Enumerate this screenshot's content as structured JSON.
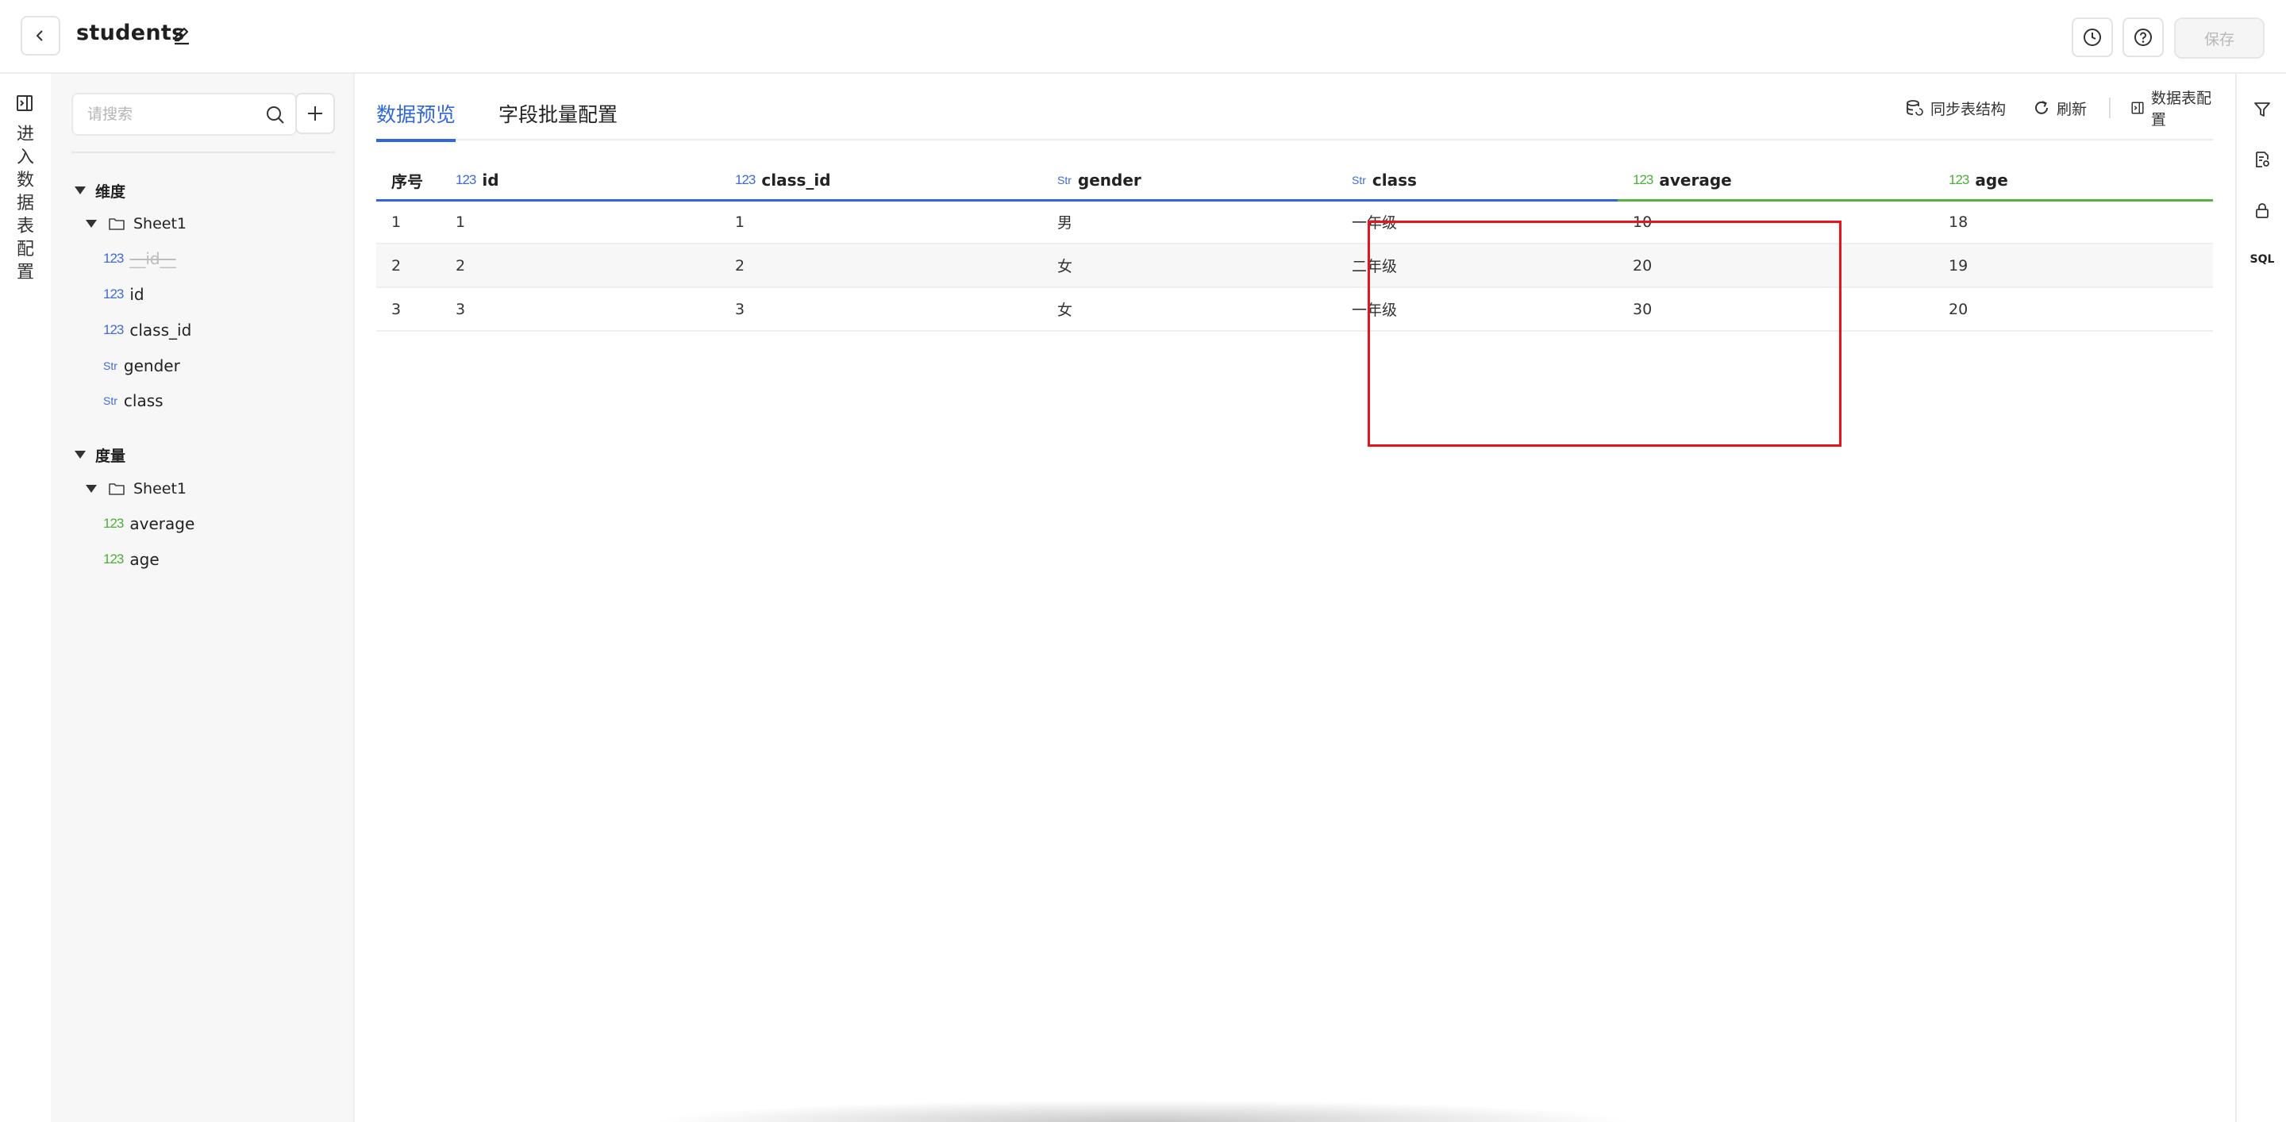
{
  "header": {
    "title": "students",
    "save_label": "保存",
    "icons": {
      "back": "chevron-left-icon",
      "edit": "pencil-icon",
      "history": "clock-icon",
      "help": "question-circle-icon"
    }
  },
  "left_rail": {
    "label_chars": [
      "进",
      "入",
      "数",
      "据",
      "表",
      "配",
      "置"
    ],
    "icon": "panel-collapse-icon"
  },
  "side_panel": {
    "search_placeholder": "请搜索",
    "dimension": {
      "label": "维度",
      "folder": "Sheet1",
      "fields": [
        {
          "type": "123",
          "name": "__id__",
          "disabled": true
        },
        {
          "type": "123",
          "name": "id"
        },
        {
          "type": "123",
          "name": "class_id"
        },
        {
          "type": "Str",
          "name": "gender"
        },
        {
          "type": "Str",
          "name": "class"
        }
      ]
    },
    "measure": {
      "label": "度量",
      "folder": "Sheet1",
      "fields": [
        {
          "type": "123",
          "name": "average"
        },
        {
          "type": "123",
          "name": "age"
        }
      ]
    }
  },
  "main": {
    "tabs": [
      {
        "label": "数据预览",
        "active": true
      },
      {
        "label": "字段批量配置",
        "active": false
      }
    ],
    "toolbar": {
      "sync_label": "同步表结构",
      "refresh_label": "刷新",
      "config_label": "数据表配置"
    },
    "table": {
      "columns": [
        {
          "type": "",
          "name": "序号"
        },
        {
          "type": "123",
          "name": "id"
        },
        {
          "type": "123",
          "name": "class_id"
        },
        {
          "type": "Str",
          "name": "gender"
        },
        {
          "type": "Str",
          "name": "class"
        },
        {
          "type": "123",
          "name": "average"
        },
        {
          "type": "123",
          "name": "age"
        }
      ],
      "rows": [
        [
          "1",
          "1",
          "1",
          "男",
          "一年级",
          "10",
          "18"
        ],
        [
          "2",
          "2",
          "2",
          "女",
          "二年级",
          "20",
          "19"
        ],
        [
          "3",
          "3",
          "3",
          "女",
          "一年级",
          "30",
          "20"
        ]
      ]
    }
  },
  "right_rail": {
    "icons": [
      "filter-icon",
      "document-settings-icon",
      "lock-icon"
    ],
    "sql_label": "SQL"
  },
  "colors": {
    "accent": "#2f68da",
    "measure_green": "#54b43c",
    "highlight_red": "#e4151c"
  }
}
